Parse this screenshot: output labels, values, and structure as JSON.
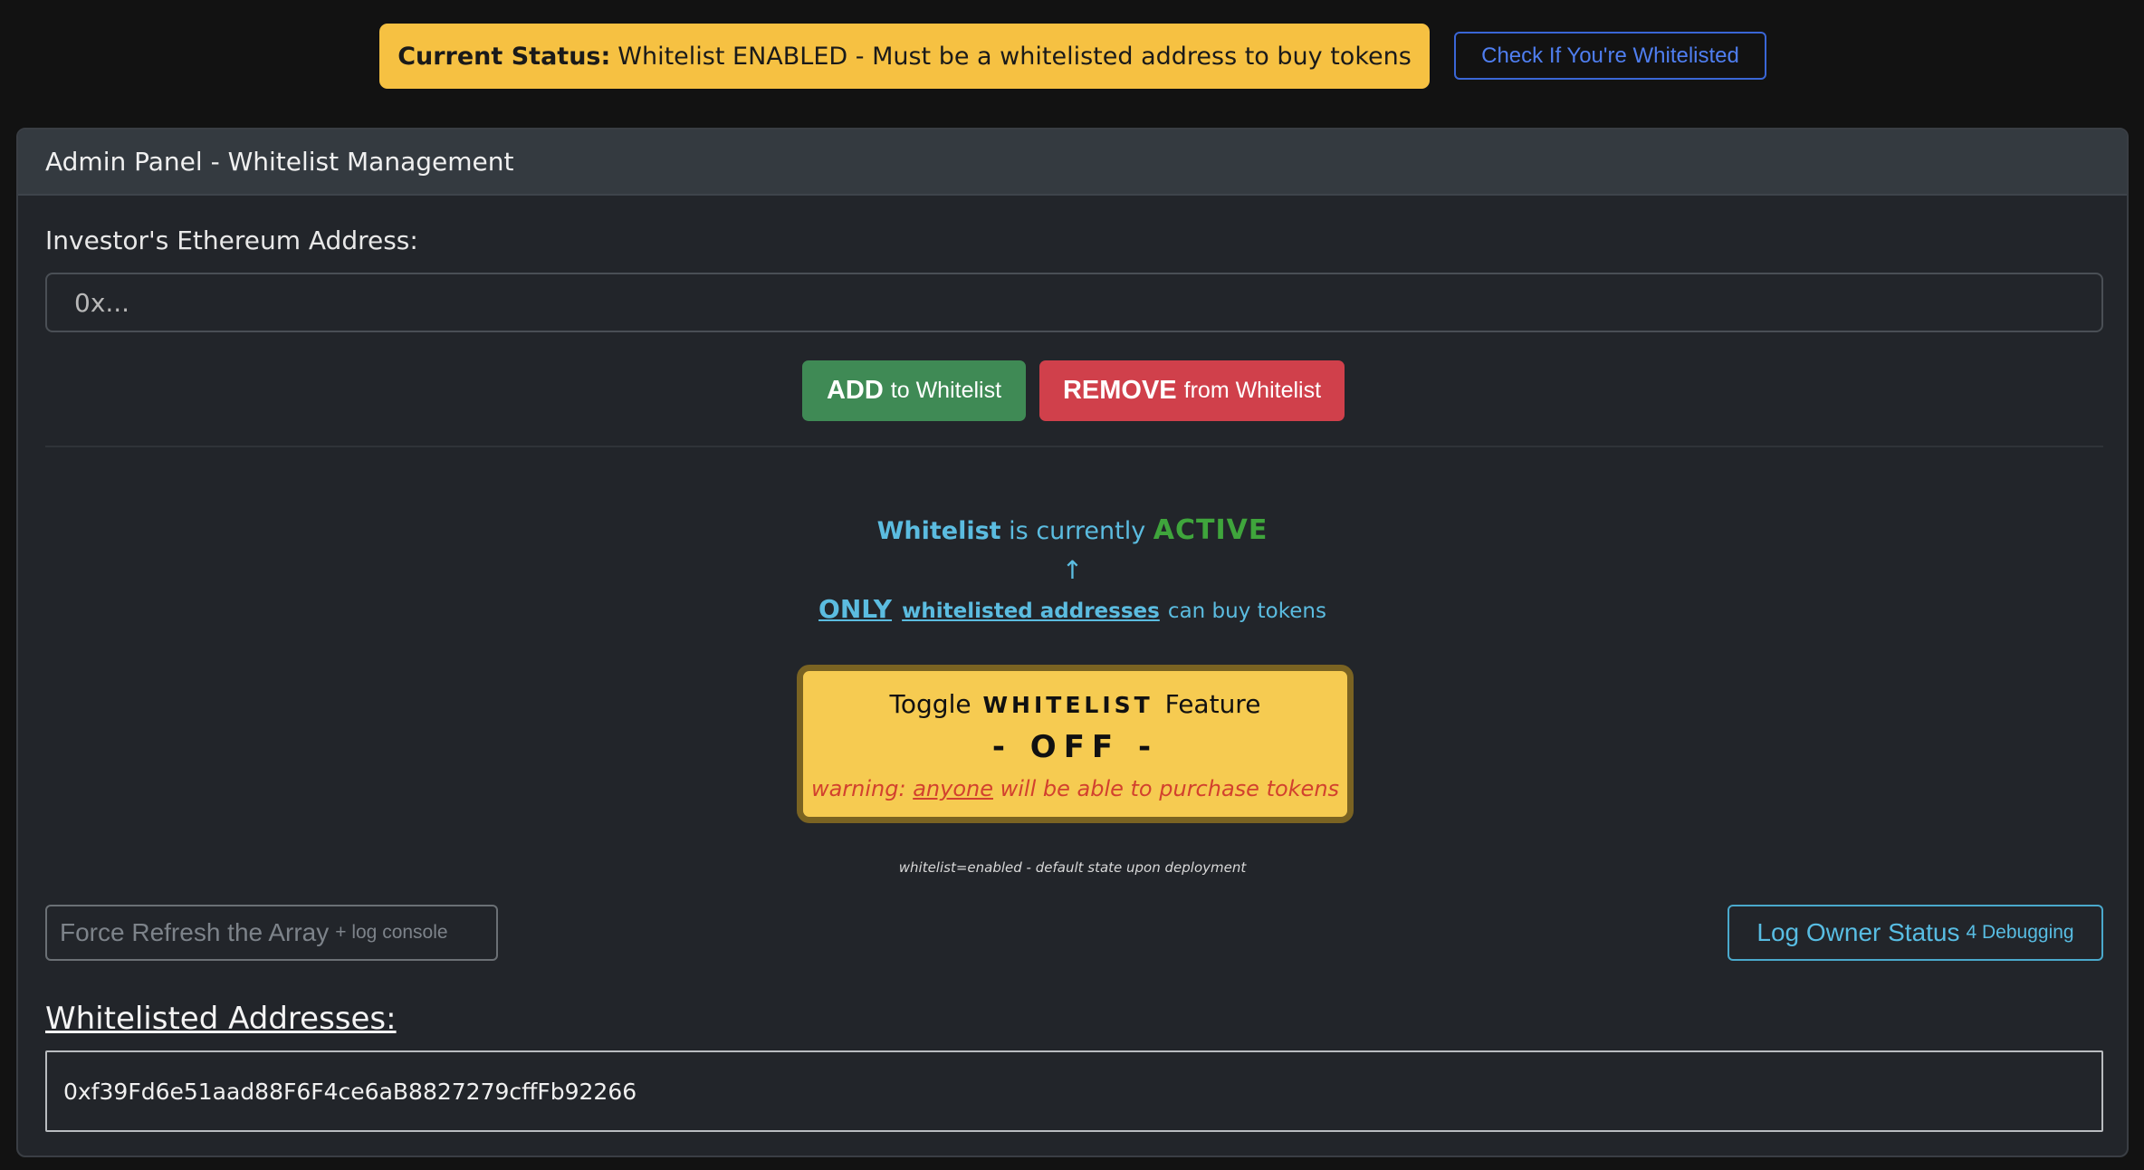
{
  "top_bar": {
    "status_label": "Current Status:",
    "status_text": "Whitelist ENABLED - Must be a whitelisted address to buy tokens",
    "check_button": "Check If You're Whitelisted"
  },
  "admin_panel": {
    "title": "Admin Panel - Whitelist Management",
    "address_label": "Investor's Ethereum Address:",
    "address_input": {
      "value": "",
      "placeholder": "0x..."
    },
    "add_button": {
      "strong": "ADD",
      "rest": "to Whitelist"
    },
    "remove_button": {
      "strong": "REMOVE",
      "rest": "from Whitelist"
    },
    "status_line": {
      "whitelist_word": "Whitelist",
      "middle": "is currently",
      "state_word": "ACTIVE"
    },
    "arrow": "↑",
    "only_line": {
      "only_word": "ONLY",
      "addresses_word": "whitelisted addresses",
      "tail": "can buy tokens"
    },
    "toggle": {
      "prefix": "Toggle",
      "caps": "WHITELIST",
      "suffix": "Feature",
      "state": "- OFF -",
      "warning_prefix": "warning:",
      "warning_anyone": "anyone",
      "warning_suffix": "will be able to purchase tokens"
    },
    "footnote": "whitelist=enabled - default state upon deployment",
    "refresh_button": {
      "main": "Force Refresh the Array",
      "small": "+ log console"
    },
    "log_button": {
      "main": "Log Owner Status",
      "small": "4 Debugging"
    },
    "list_heading": "Whitelisted Addresses:",
    "whitelisted_addresses": [
      "0xf39Fd6e51aad88F6F4ce6aB8827279cffFb92266"
    ]
  }
}
